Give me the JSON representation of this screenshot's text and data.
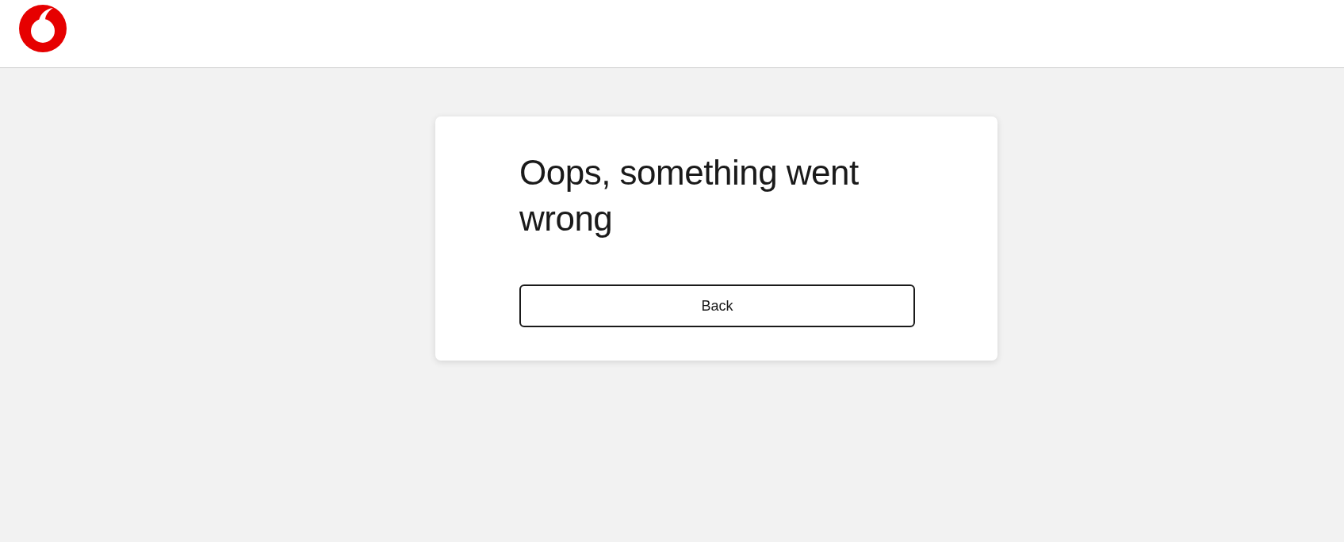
{
  "error_card": {
    "title": "Oops, something went wrong",
    "back_button": {
      "label": "Back"
    }
  }
}
